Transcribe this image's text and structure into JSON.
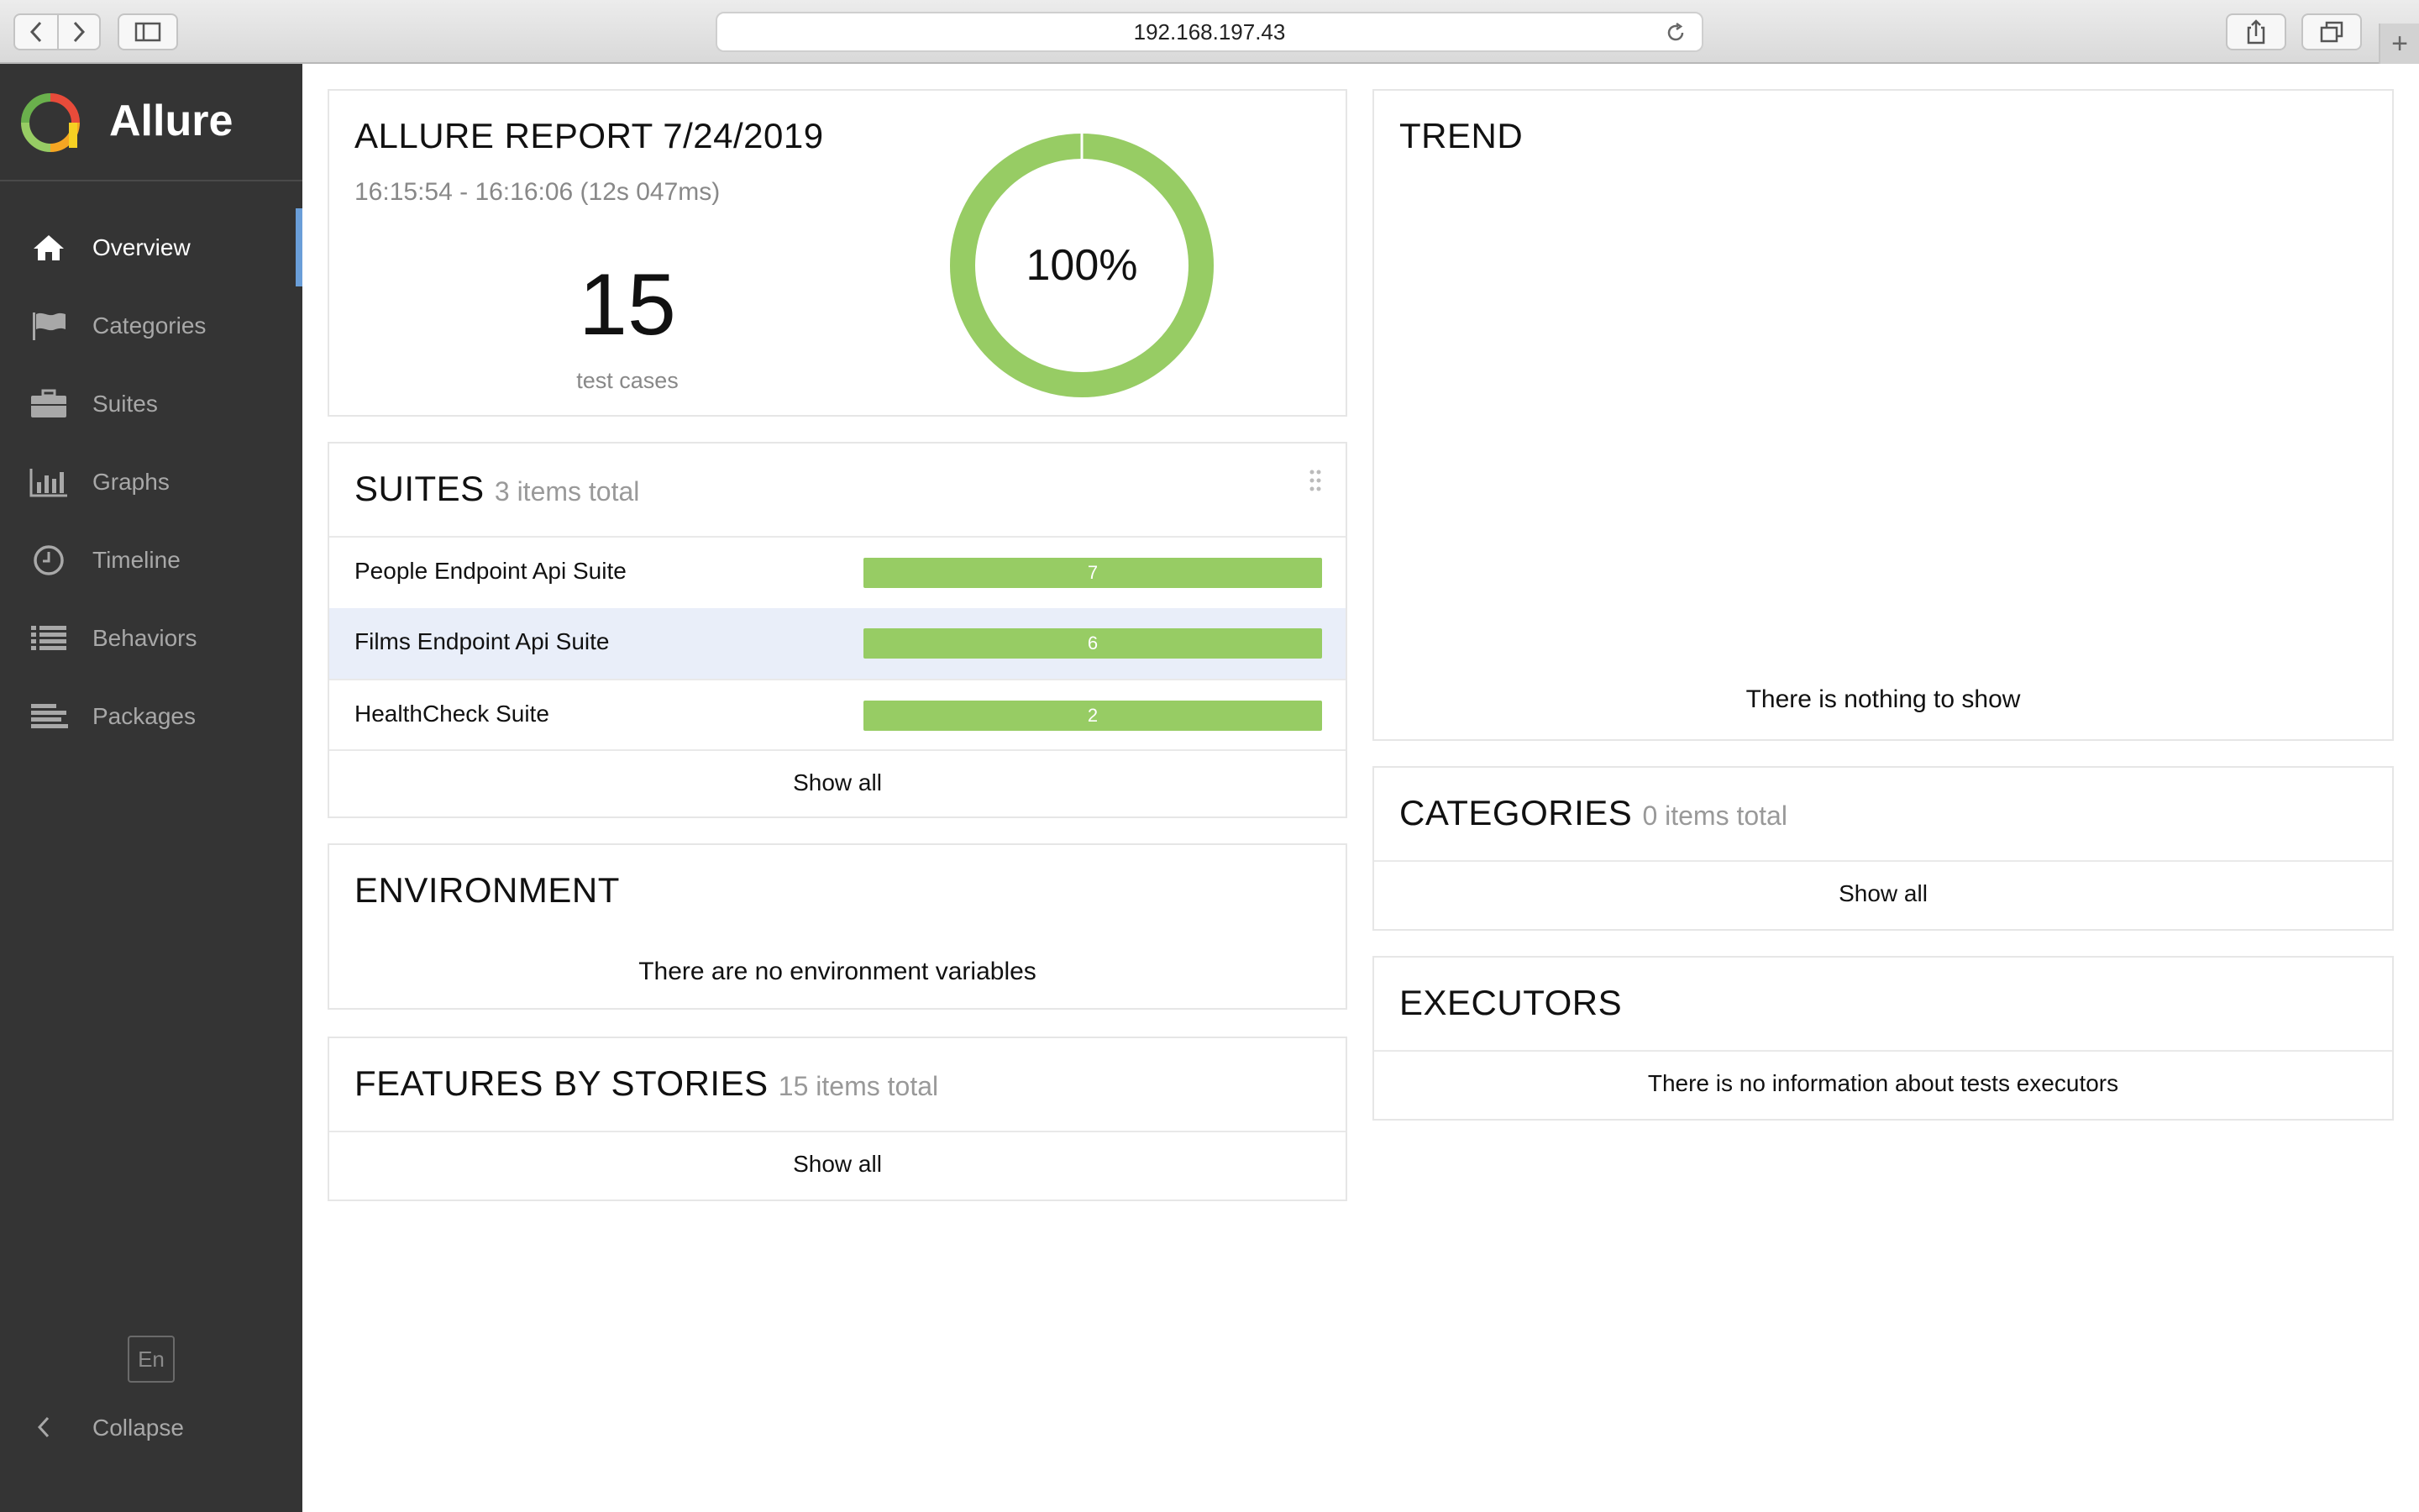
{
  "browser": {
    "address": "192.168.197.43"
  },
  "sidebar": {
    "brand": "Allure",
    "items": [
      {
        "label": "Overview",
        "icon": "home-icon",
        "active": true
      },
      {
        "label": "Categories",
        "icon": "flag-icon",
        "active": false
      },
      {
        "label": "Suites",
        "icon": "briefcase-icon",
        "active": false
      },
      {
        "label": "Graphs",
        "icon": "bar-chart-icon",
        "active": false
      },
      {
        "label": "Timeline",
        "icon": "clock-icon",
        "active": false
      },
      {
        "label": "Behaviors",
        "icon": "list-icon",
        "active": false
      },
      {
        "label": "Packages",
        "icon": "align-left-icon",
        "active": false
      }
    ],
    "language": "En",
    "collapse_label": "Collapse"
  },
  "summary": {
    "title": "ALLURE REPORT 7/24/2019",
    "time": "16:15:54 - 16:16:06 (12s 047ms)",
    "count": "15",
    "count_label": "test cases",
    "percent_label": "100%",
    "passed_fraction": 1.0,
    "passed_color": "#97cc64"
  },
  "suites": {
    "title": "SUITES",
    "subtitle": "3 items total",
    "rows": [
      {
        "name": "People Endpoint Api Suite",
        "count": "7"
      },
      {
        "name": "Films Endpoint Api Suite",
        "count": "6"
      },
      {
        "name": "HealthCheck Suite",
        "count": "2"
      }
    ],
    "show_all": "Show all"
  },
  "environment": {
    "title": "ENVIRONMENT",
    "message": "There are no environment variables"
  },
  "features": {
    "title": "FEATURES BY STORIES",
    "subtitle": "15 items total",
    "show_all": "Show all"
  },
  "trend": {
    "title": "TREND",
    "message": "There is nothing to show"
  },
  "categories": {
    "title": "CATEGORIES",
    "subtitle": "0 items total",
    "show_all": "Show all"
  },
  "executors": {
    "title": "EXECUTORS",
    "message": "There is no information about tests executors"
  },
  "colors": {
    "sidebar_bg": "#343434",
    "active_indicator": "#6a9ed8",
    "row_highlight": "#e9eef9",
    "bar_green": "#97cc64"
  }
}
